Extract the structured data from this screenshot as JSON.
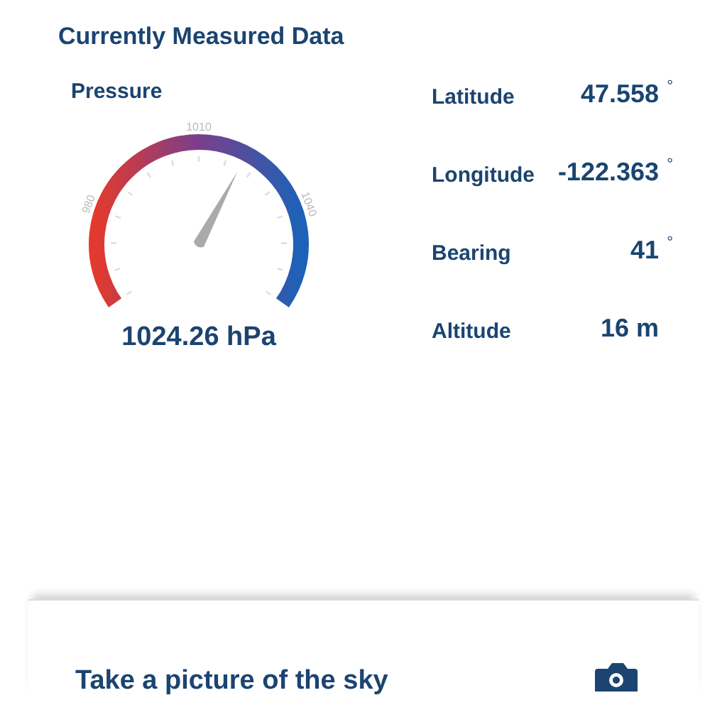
{
  "section_title": "Currently Measured Data",
  "pressure": {
    "label": "Pressure",
    "reading": "1024.26 hPa",
    "tick_labels": [
      "980",
      "1010",
      "1040"
    ]
  },
  "measurements": [
    {
      "label": "Latitude",
      "value": "47.558",
      "unit": "°"
    },
    {
      "label": "Longitude",
      "value": "-122.363",
      "unit": "°"
    },
    {
      "label": "Bearing",
      "value": "41",
      "unit": "°"
    },
    {
      "label": "Altitude",
      "value": "16 m"
    }
  ],
  "sky_card": {
    "label": "Take a picture of the sky"
  }
}
